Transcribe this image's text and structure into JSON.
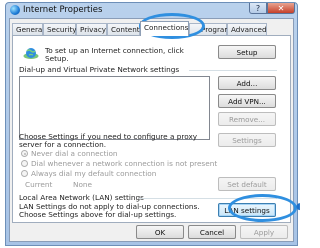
{
  "window": {
    "title": "Internet Properties",
    "help_label": "?",
    "close_label": "✕"
  },
  "tabs": [
    "General",
    "Security",
    "Privacy",
    "Content",
    "Connections",
    "Programs",
    "Advanced"
  ],
  "active_tab": "Connections",
  "setup": {
    "text_line1": "To set up an Internet connection, click",
    "text_line2": "Setup.",
    "button": "Setup"
  },
  "dialup": {
    "heading": "Dial-up and Virtual Private Network settings",
    "buttons": {
      "add": "Add...",
      "add_vpn": "Add VPN...",
      "remove": "Remove...",
      "settings": "Settings"
    },
    "proxy_text_line1": "Choose Settings if you need to configure a proxy",
    "proxy_text_line2": "server for a connection.",
    "radios": [
      "Never dial a connection",
      "Dial whenever a network connection is not present",
      "Always dial my default connection"
    ],
    "current_label": "Current",
    "current_value": "None",
    "set_default": "Set default"
  },
  "lan": {
    "heading": "Local Area Network (LAN) settings",
    "text_line1": "LAN Settings do not apply to dial-up connections.",
    "text_line2": "Choose Settings above for dial-up settings.",
    "button": "LAN settings"
  },
  "footer": {
    "ok": "OK",
    "cancel": "Cancel",
    "apply": "Apply"
  },
  "colors": {
    "highlight": "#2f8fe0",
    "frame": "#b9d1ec"
  },
  "icons": {
    "globe": "globe-network-icon",
    "app": "internet-options-icon"
  }
}
